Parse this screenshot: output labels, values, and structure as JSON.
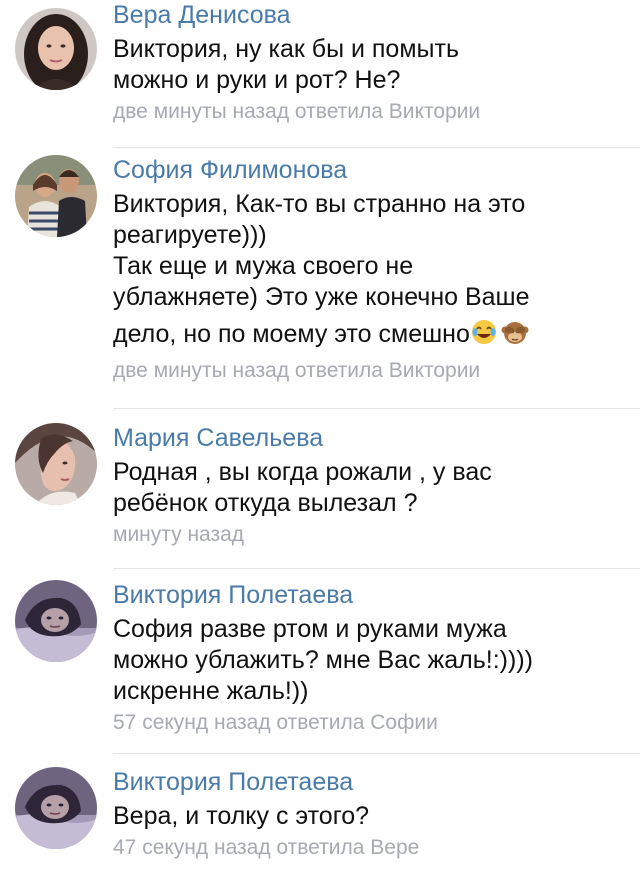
{
  "comments": [
    {
      "author": "Вера Денисова",
      "lines": [
        "Виктория, ну как бы и помыть",
        "можно и руки и рот?  Не?"
      ],
      "meta": "две минуты назад ответила Виктории",
      "avatar": "woman-dark-hair-avatar"
    },
    {
      "author": "София Филимонова",
      "lines": [
        "Виктория, Как-то вы странно на это",
        "реагируете)))",
        "Так еще и мужа своего не",
        "ублажняете) Это уже конечно Ваше",
        "дело, но по моему это смешно"
      ],
      "emojis": [
        "face-with-tears-of-joy-icon",
        "see-no-evil-monkey-icon"
      ],
      "meta": "две минуты назад ответила Виктории",
      "avatar": "couple-photo-avatar"
    },
    {
      "author": "Мария Савельева",
      "lines": [
        "Родная , вы когда рожали , у вас",
        "ребёнок откуда вылезал ?"
      ],
      "meta": "минуту назад",
      "avatar": "woman-side-profile-avatar"
    },
    {
      "author": "Виктория Полетаева",
      "lines": [
        "София разве ртом и руками мужа",
        "можно ублажить? мне Вас жаль!:))))",
        "искренне жаль!))"
      ],
      "meta": "57 секунд назад ответила Софии",
      "avatar": "woman-purple-tint-avatar"
    },
    {
      "author": "Виктория Полетаева",
      "lines": [
        "Вера, и толку с этого?"
      ],
      "meta": "47 секунд назад ответила Вере",
      "avatar": "woman-purple-tint-avatar"
    }
  ],
  "colors": {
    "author": "#4a7ba8",
    "text": "#111111",
    "meta": "#a6aab0",
    "divider": "#e3e5e8"
  }
}
